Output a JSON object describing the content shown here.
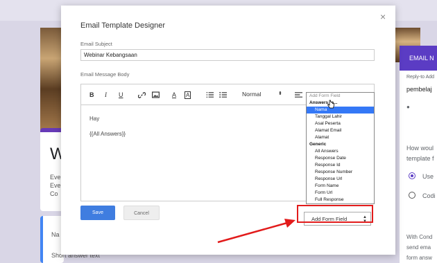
{
  "background": {
    "heading_fragment": "W",
    "line1": "Eve",
    "line2": "Eve",
    "line3": "Co",
    "name_fragment": "Na",
    "short_answer": "Short answer text",
    "side": {
      "header": "EMAIL N",
      "reply_to": "Reply-to Add",
      "reply_value": "pembelaj",
      "q1": "How woul",
      "q2": "template f",
      "opt_use": "Use",
      "opt_code": "Codi",
      "with1": "With Cond",
      "with2": "send ema",
      "with3": "form answ"
    }
  },
  "dialog": {
    "title": "Email Template Designer",
    "close": "×",
    "subject_label": "Email Subject",
    "subject_value": "Webinar Kebangsaan",
    "body_label": "Email Message Body",
    "toolbar": {
      "bold": "B",
      "italic": "I",
      "underline": "U",
      "font_color": "A",
      "highlight": "A",
      "heading": "Normal",
      "heading_arrow": "⬍",
      "clear": "T"
    },
    "body_lines": [
      "Hay",
      "{{All Answers}}"
    ],
    "save": "Save",
    "cancel": "Cancel",
    "form_field_select": "Add Form Field",
    "dropdown": {
      "placeholder": "Add Form Field",
      "group_answers": "Answers to...",
      "answers": [
        "Nama",
        "Tanggal Lahir",
        "Asal Peserta",
        "Alamat Email",
        "Alamat"
      ],
      "selected": "Nama",
      "group_generic": "Generic",
      "generic": [
        "All Answers",
        "Response Date",
        "Response Id",
        "Response Number",
        "Response Url",
        "Form Name",
        "Form Url",
        "Full Response"
      ]
    }
  },
  "colors": {
    "accent_purple": "#5b3cc4",
    "save_blue": "#3f7de0",
    "annotation_red": "#e21b1b",
    "selection_blue": "#3478f6"
  }
}
